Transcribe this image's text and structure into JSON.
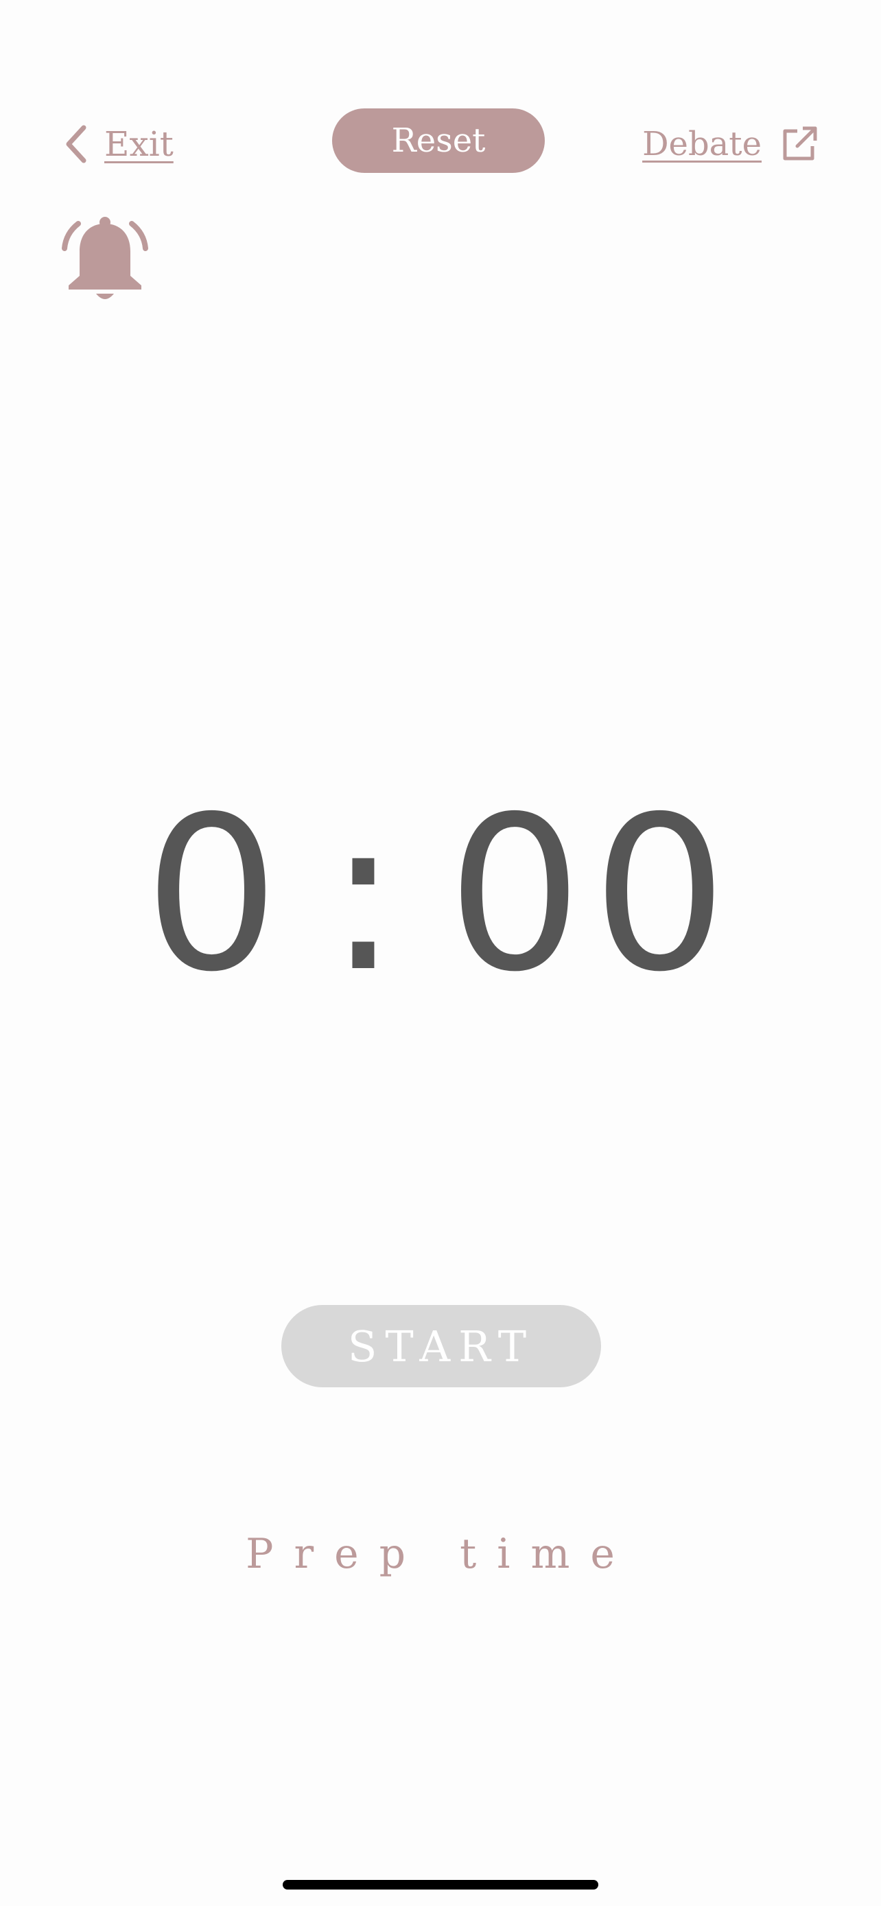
{
  "top_bar": {
    "exit_label": "Exit",
    "reset_label": "Reset",
    "debate_label": "Debate"
  },
  "icons": {
    "back": "chevron-left-icon",
    "external": "external-link-icon",
    "alarm": "bell-ringing-icon"
  },
  "timer": {
    "minutes": "0",
    "separator": ":",
    "seconds": "00"
  },
  "start_label": "START",
  "phase_label": "Prep time",
  "colors": {
    "accent": "#bc9a9a",
    "timer_text": "#565656",
    "start_disabled_bg": "#d8d8d8",
    "background": "#fdfdfd"
  }
}
